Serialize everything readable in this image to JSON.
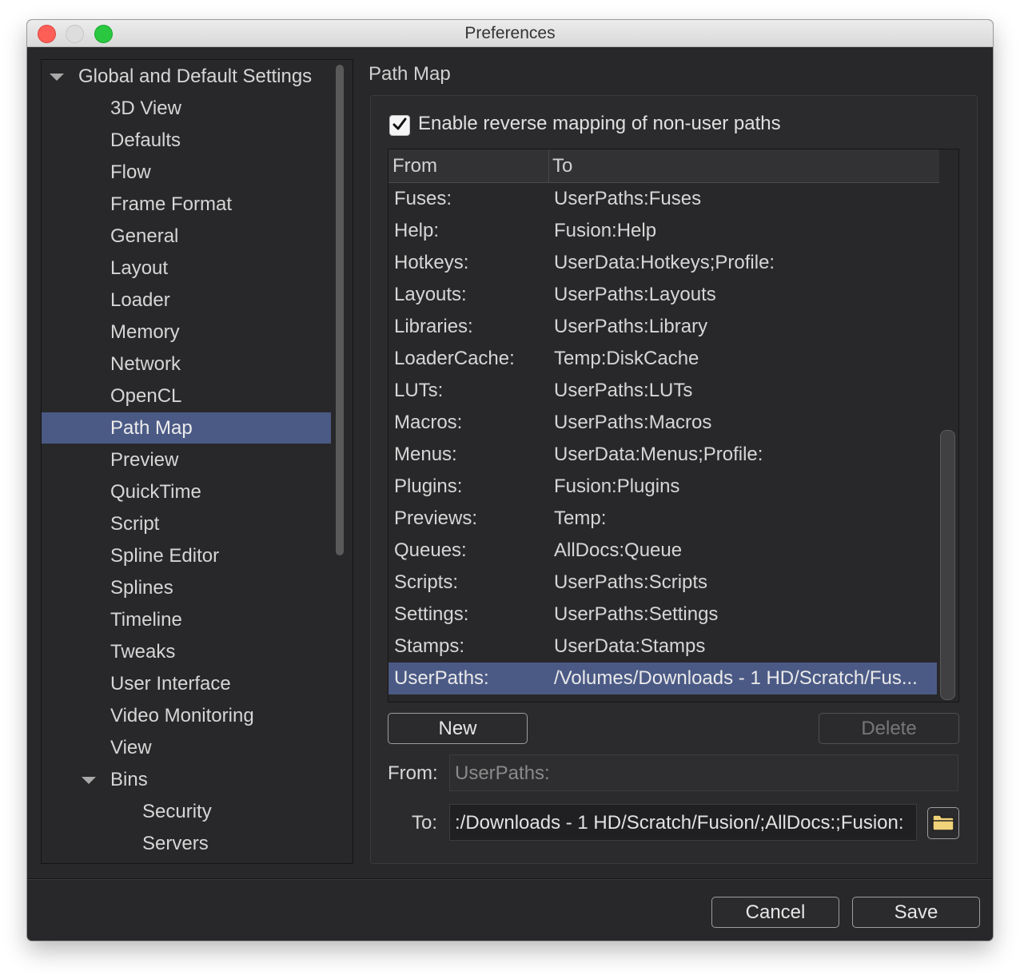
{
  "window": {
    "title": "Preferences"
  },
  "sidebar": {
    "items": [
      {
        "label": "Global and Default Settings",
        "expanded": true
      },
      {
        "label": "3D View"
      },
      {
        "label": "Defaults"
      },
      {
        "label": "Flow"
      },
      {
        "label": "Frame Format"
      },
      {
        "label": "General"
      },
      {
        "label": "Layout"
      },
      {
        "label": "Loader"
      },
      {
        "label": "Memory"
      },
      {
        "label": "Network"
      },
      {
        "label": "OpenCL"
      },
      {
        "label": "Path Map",
        "selected": true
      },
      {
        "label": "Preview"
      },
      {
        "label": "QuickTime"
      },
      {
        "label": "Script"
      },
      {
        "label": "Spline Editor"
      },
      {
        "label": "Splines"
      },
      {
        "label": "Timeline"
      },
      {
        "label": "Tweaks"
      },
      {
        "label": "User Interface"
      },
      {
        "label": "Video Monitoring"
      },
      {
        "label": "View"
      },
      {
        "label": "Bins",
        "expanded": true
      },
      {
        "label": "Security"
      },
      {
        "label": "Servers"
      }
    ]
  },
  "main": {
    "section_title": "Path Map",
    "reverse_mapping": {
      "label": "Enable reverse mapping of non-user paths",
      "checked": true
    },
    "table": {
      "columns": [
        "From",
        "To"
      ],
      "rows": [
        [
          "Fuses:",
          "UserPaths:Fuses"
        ],
        [
          "Help:",
          "Fusion:Help"
        ],
        [
          "Hotkeys:",
          "UserData:Hotkeys;Profile:"
        ],
        [
          "Layouts:",
          "UserPaths:Layouts"
        ],
        [
          "Libraries:",
          "UserPaths:Library"
        ],
        [
          "LoaderCache:",
          "Temp:DiskCache"
        ],
        [
          "LUTs:",
          "UserPaths:LUTs"
        ],
        [
          "Macros:",
          "UserPaths:Macros"
        ],
        [
          "Menus:",
          "UserData:Menus;Profile:"
        ],
        [
          "Plugins:",
          "Fusion:Plugins"
        ],
        [
          "Previews:",
          "Temp:"
        ],
        [
          "Queues:",
          "AllDocs:Queue"
        ],
        [
          "Scripts:",
          "UserPaths:Scripts"
        ],
        [
          "Settings:",
          "UserPaths:Settings"
        ],
        [
          "Stamps:",
          "UserData:Stamps"
        ],
        [
          "UserPaths:",
          "/Volumes/Downloads - 1 HD/Scratch/Fus..."
        ]
      ],
      "selected_row": 15
    },
    "new_button": "New",
    "delete_button": "Delete",
    "from_label": "From:",
    "from_value": "UserPaths:",
    "to_label": "To:",
    "to_value": ":/Downloads - 1 HD/Scratch/Fusion/;AllDocs:;Fusion:"
  },
  "footer": {
    "cancel": "Cancel",
    "save": "Save"
  },
  "colors": {
    "selection": "#4b5a85",
    "background": "#28282a",
    "folder": "#f0d37a"
  }
}
